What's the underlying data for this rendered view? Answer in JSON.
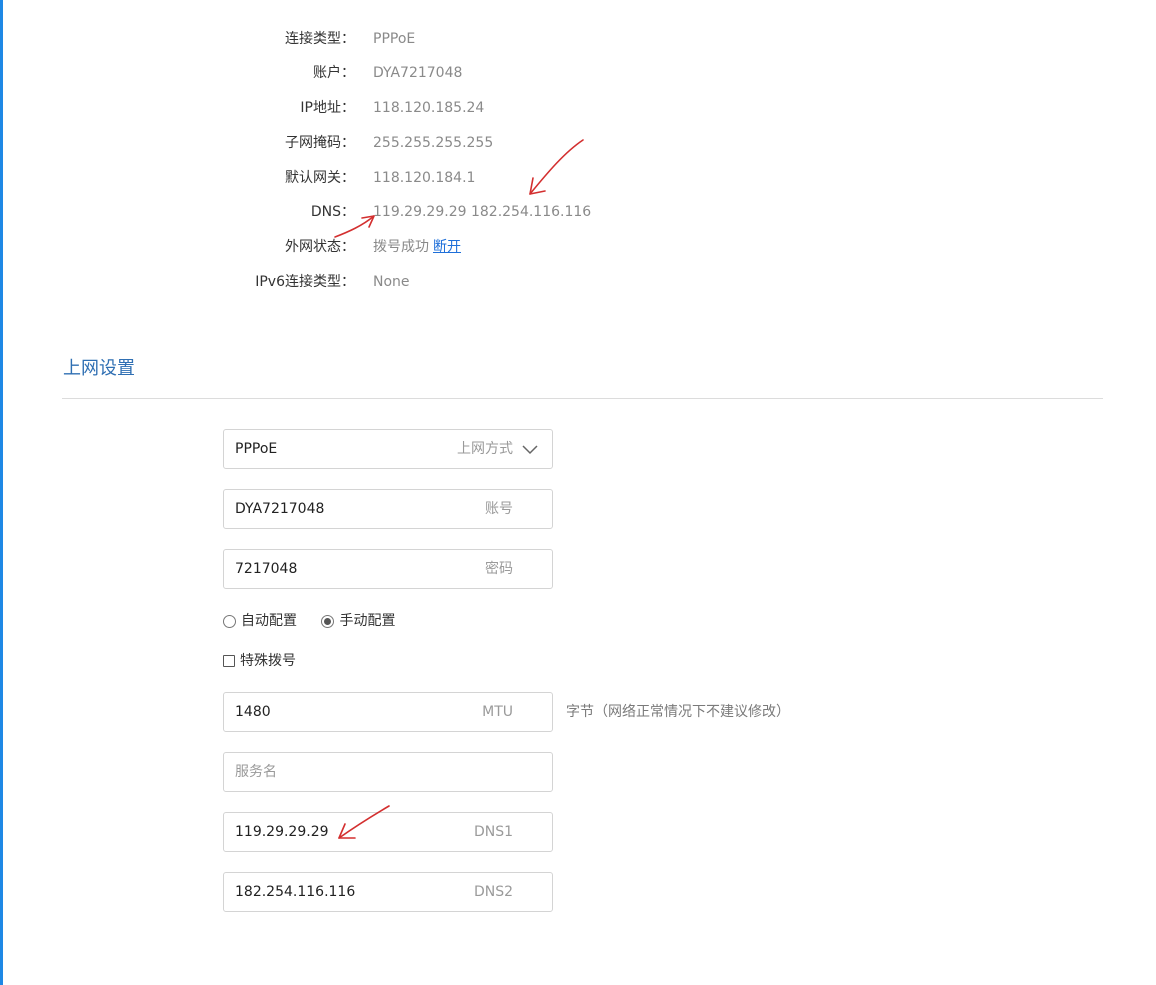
{
  "status": {
    "rows": [
      {
        "label": "连接类型：",
        "value": "PPPoE"
      },
      {
        "label": "账户：",
        "value": "DYA7217048"
      },
      {
        "label": "IP地址：",
        "value": "118.120.185.24"
      },
      {
        "label": "子网掩码：",
        "value": "255.255.255.255"
      },
      {
        "label": "默认网关：",
        "value": "118.120.184.1"
      },
      {
        "label": "DNS：",
        "value": "119.29.29.29 182.254.116.116"
      },
      {
        "label": "外网状态：",
        "value": "拨号成功",
        "link": "断开"
      },
      {
        "label": "IPv6连接类型：",
        "value": "None"
      }
    ]
  },
  "settings": {
    "title": "上网设置",
    "connection_type": {
      "value": "PPPoE",
      "suffix": "上网方式"
    },
    "account": {
      "value": "DYA7217048",
      "suffix": "账号"
    },
    "password": {
      "value": "7217048",
      "suffix": "密码"
    },
    "dns_mode": {
      "options": [
        "自动配置",
        "手动配置"
      ],
      "selected": "手动配置"
    },
    "special_dial": {
      "label": "特殊拨号",
      "checked": false
    },
    "mtu": {
      "value": "1480",
      "suffix": "MTU",
      "hint": "字节（网络正常情况下不建议修改）"
    },
    "service_name": {
      "value": "",
      "placeholder": "服务名"
    },
    "dns1": {
      "value": "119.29.29.29",
      "suffix": "DNS1"
    },
    "dns2": {
      "value": "182.254.116.116",
      "suffix": "DNS2"
    }
  },
  "colors": {
    "accent": "#1e88e5",
    "title": "#2f6fb3",
    "annotation": "#d32f2f"
  }
}
